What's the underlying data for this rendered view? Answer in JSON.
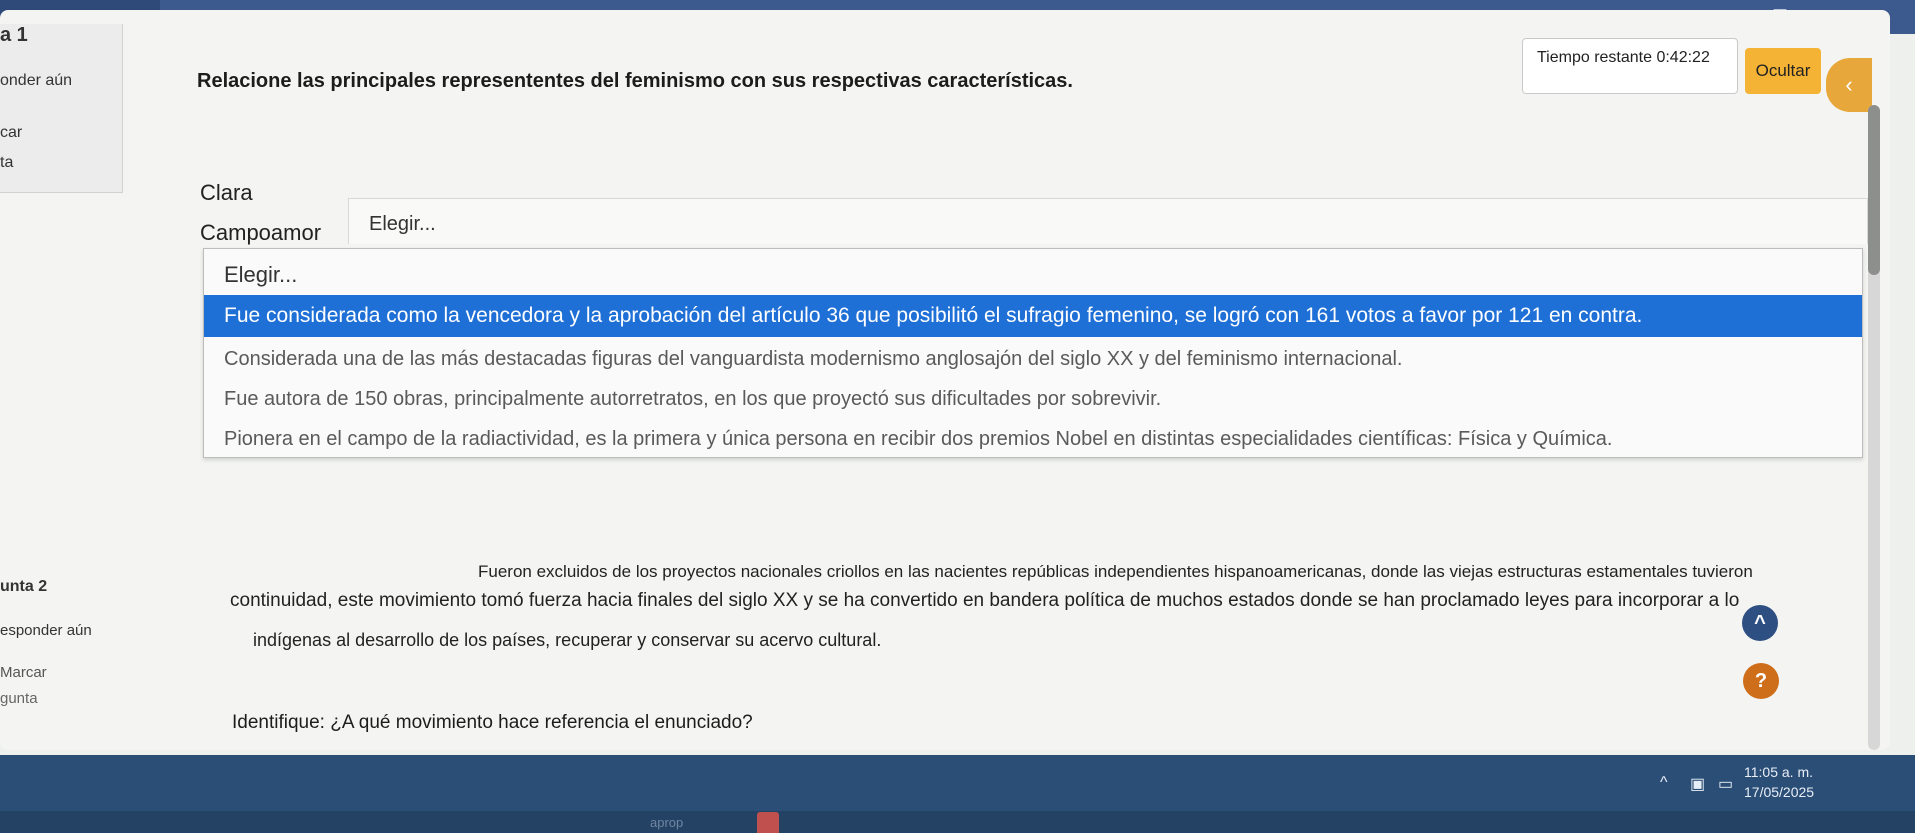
{
  "question1": {
    "label": "a 1",
    "status": "onder aún",
    "mark": "car",
    "flag": "ta",
    "text": "Relacione las principales represententes del feminismo con sus respectivas características.",
    "timer": "Tiempo restante 0:42:22",
    "hide_button": "Ocultar",
    "side_toggle_icon": "chevron-left-icon",
    "match": {
      "name_line1": "Clara",
      "name_line2": "Campoamor",
      "selected": "Elegir...",
      "options": [
        "Elegir...",
        "Fue considerada como la vencedora y la aprobación del artículo 36 que posibilitó el sufragio femenino, se logró con 161 votos a favor por 121 en contra.",
        "Considerada una de las más destacadas figuras del vanguardista modernismo anglosajón del siglo XX y del feminismo internacional.",
        "Fue autora de 150 obras, principalmente autorretratos, en los que proyectó sus dificultades por sobrevivir.",
        "Pionera en el campo de la radiactividad, es la primera y única persona en recibir dos premios Nobel en distintas especialidades científicas: Física y Química."
      ]
    }
  },
  "question2": {
    "label": "unta 2",
    "status": "esponder aún",
    "mark": "Marcar",
    "flag": "gunta",
    "line_top": "Fueron excluidos de los proyectos nacionales criollos en las nacientes repúblicas independientes hispanoamericanas, donde las viejas estructuras estamentales tuvieron",
    "line1": "continuidad, este movimiento tomó fuerza hacia finales del siglo XX y se ha convertido en bandera política de muchos estados donde se han proclamado leyes para incorporar a lo",
    "line2": "indígenas al desarrollo de los países, recuperar y conservar su acervo cultural.",
    "identify_label": "Identifique:",
    "identify_question": "¿A qué movimiento hace referencia el enunciado?"
  },
  "floating": {
    "up_icon": "^",
    "help_icon": "?"
  },
  "taskbar": {
    "time": "11:05 a. m.",
    "date": "17/05/2025",
    "tray_up": "^",
    "label": "aprop"
  },
  "colors": {
    "highlight": "#1e6fd6",
    "accent": "#f5b335",
    "taskbar": "#2b4e77"
  }
}
